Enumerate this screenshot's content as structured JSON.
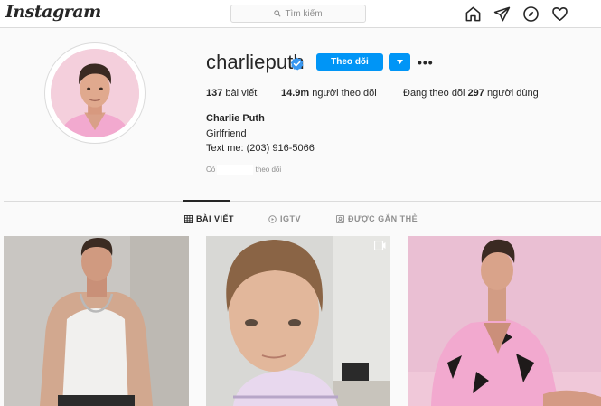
{
  "header": {
    "logo": "Instagram",
    "search_placeholder": "Tìm kiếm",
    "nav_icons": [
      "home-icon",
      "direct-message-icon",
      "explore-compass-icon",
      "activity-heart-icon"
    ]
  },
  "profile": {
    "username": "charlieputh",
    "verified": true,
    "follow_label": "Theo dõi",
    "stats": {
      "posts_count": "137",
      "posts_label": " bài viết",
      "followers_count": "14.9m",
      "followers_label": " người theo dõi",
      "following_prefix": "Đang theo dõi ",
      "following_count": "297",
      "following_label": " người dùng"
    },
    "full_name": "Charlie Puth",
    "bio_line1": "Girlfriend",
    "bio_line2": "Text me: (203) 916-5066",
    "followed_by_prefix": "Có ",
    "followed_by_suffix": " theo dõi"
  },
  "tabs": [
    {
      "label": "BÀI VIẾT",
      "icon": "grid-icon",
      "active": true
    },
    {
      "label": "IGTV",
      "icon": "igtv-icon",
      "active": false
    },
    {
      "label": "ĐƯỢC GẮN THẺ",
      "icon": "tagged-icon",
      "active": false
    }
  ],
  "colors": {
    "accent": "#0095f6",
    "verified": "#3897f0",
    "pink_shirt": "#f2a9cf"
  }
}
